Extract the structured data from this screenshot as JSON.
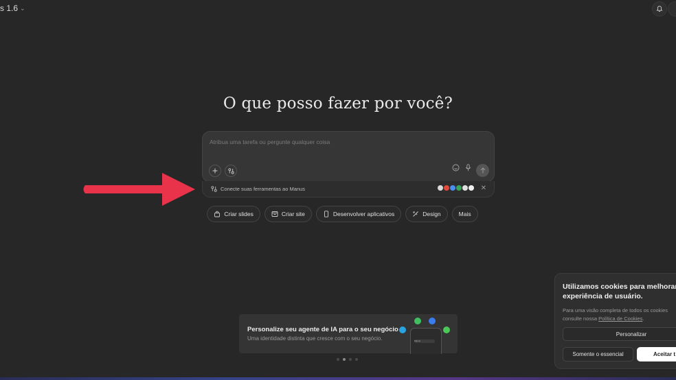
{
  "header": {
    "version_label": "s 1.6"
  },
  "main": {
    "headline": "O que posso fazer por você?",
    "composer": {
      "placeholder": "Atribua uma tarefa ou pergunte qualquer coisa",
      "connect_text": "Conecte suas ferramentas ao Manus"
    },
    "chips": [
      {
        "label": "Criar slides",
        "icon": "presentation-icon"
      },
      {
        "label": "Criar site",
        "icon": "browser-window-icon"
      },
      {
        "label": "Desenvolver aplicativos",
        "icon": "phone-icon"
      },
      {
        "label": "Design",
        "icon": "brush-icon"
      },
      {
        "label": "Mais",
        "icon": ""
      }
    ]
  },
  "promo": {
    "title": "Personalize seu agente de IA para o seu negócio",
    "subtitle": "Uma identidade distinta que cresce com o seu negócio.",
    "phone_label": "Manus",
    "carousel_active": 2,
    "carousel_total": 4
  },
  "cookie_banner": {
    "title": "Utilizamos cookies para melhorar s experiência de usuário.",
    "title_line1": "Utilizamos cookies para melhorar s",
    "title_line2": "experiência de usuário.",
    "body_line1": "Para uma visão completa de todos os cookies",
    "body_line2_prefix": "consulte nossa ",
    "policy_link": "Política de Cookies",
    "body_line2_suffix": ".",
    "personalize_label": "Personalizar",
    "essential_label": "Somente o essencial",
    "accept_label": "Aceitar t"
  },
  "colors": {
    "background": "#272727",
    "annotation_arrow": "#e8334a",
    "accept_button": "#ffffff"
  }
}
